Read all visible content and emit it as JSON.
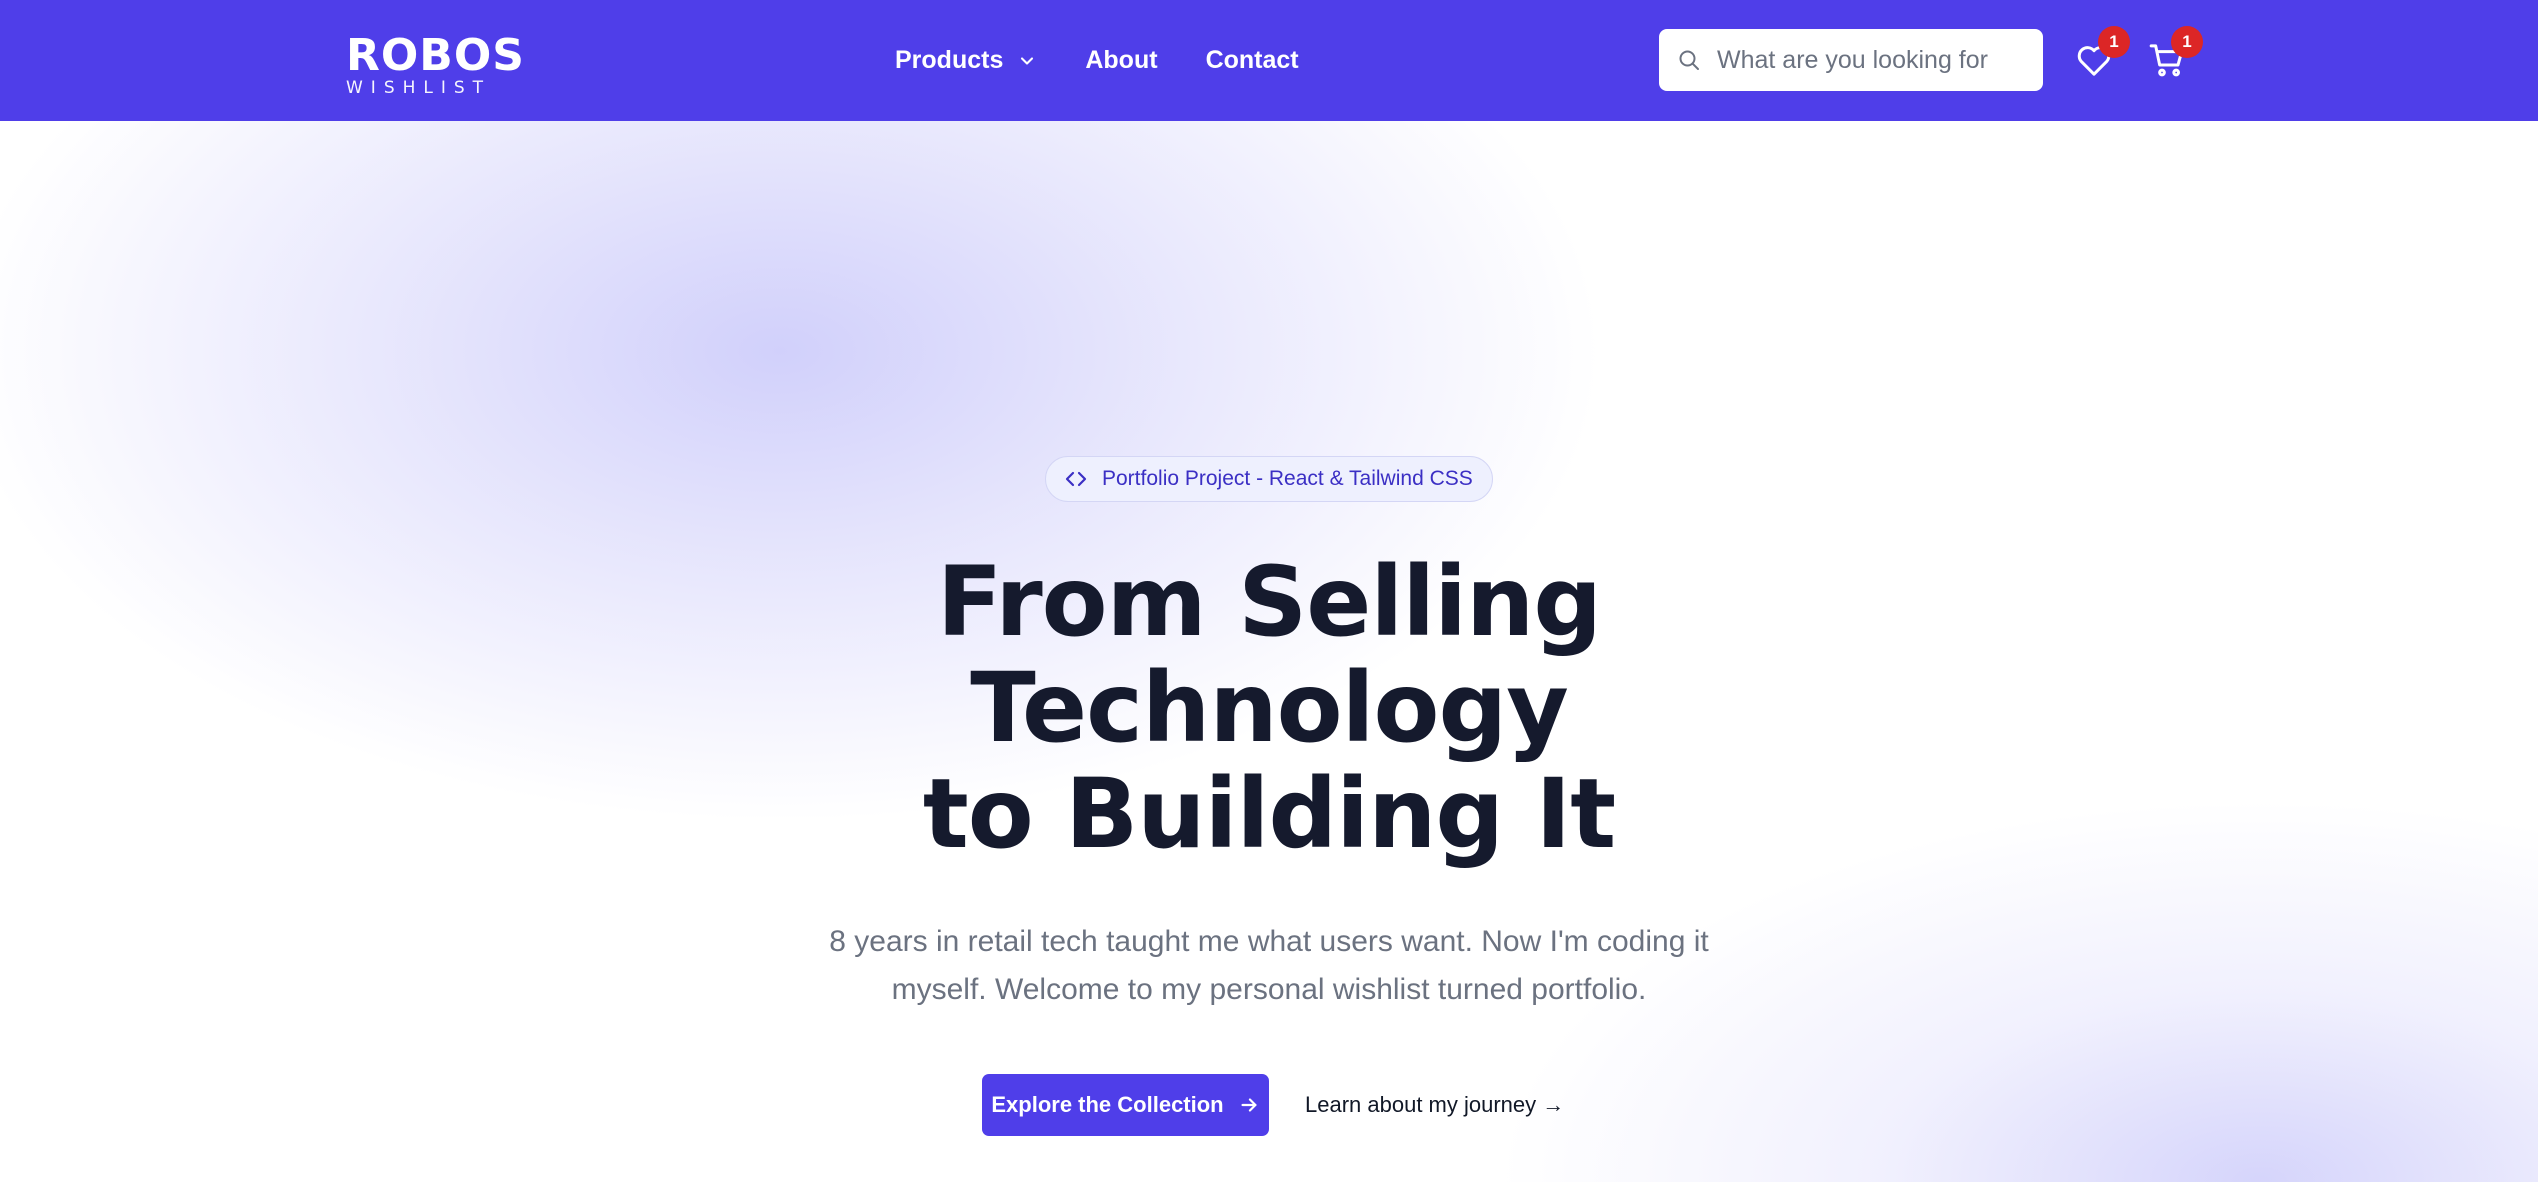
{
  "brand": {
    "name": "ROBOS",
    "tagline": "WISHLIST"
  },
  "nav": {
    "items": [
      {
        "label": "Products",
        "has_dropdown": true
      },
      {
        "label": "About"
      },
      {
        "label": "Contact"
      }
    ]
  },
  "search": {
    "placeholder": "What are you looking for",
    "icon": "search-icon"
  },
  "header_icons": {
    "wishlist": {
      "icon": "heart-icon",
      "badge": "1"
    },
    "cart": {
      "icon": "cart-icon",
      "badge": "1"
    }
  },
  "hero": {
    "pill": {
      "icon": "code-icon",
      "text": "Portfolio Project - React & Tailwind CSS"
    },
    "headline_lines": [
      "From Selling",
      "Technology",
      "to Building It"
    ],
    "subtext_lines": [
      "8 years in retail tech taught me what users want. Now I'm coding it",
      "myself. Welcome to my personal wishlist turned portfolio."
    ],
    "primary_cta": {
      "label": "Explore the Collection",
      "icon": "arrow-right-icon"
    },
    "secondary_cta": {
      "label": "Learn about my journey →"
    }
  },
  "colors": {
    "primary": "#4f3ee9",
    "badge": "#dc2626",
    "headline": "#151a2d",
    "subtext": "#6b7280",
    "pill_text": "#3b2fc4"
  }
}
